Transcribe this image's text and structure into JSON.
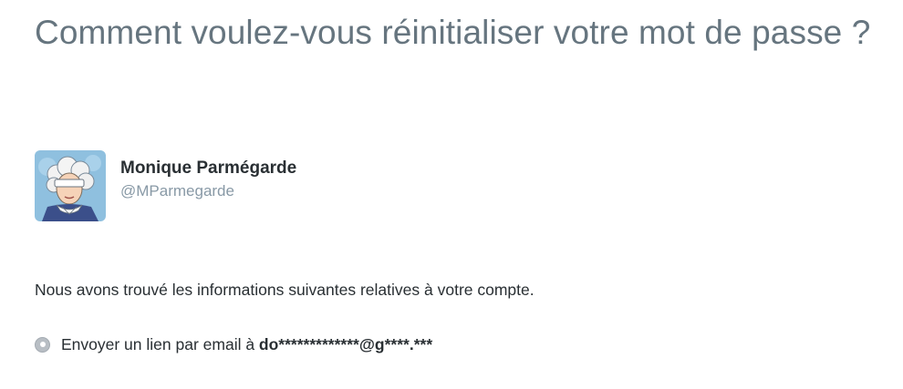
{
  "page": {
    "title": "Comment voulez-vous réinitialiser votre mot de passe ?"
  },
  "account": {
    "avatar_icon": "user-avatar-illustration",
    "name": "Monique Parmégarde",
    "screen_name": "@MParmegarde"
  },
  "info": {
    "found_text": "Nous avons trouvé les informations suivantes relatives à votre compte."
  },
  "reset_option": {
    "label": "Envoyer un lien par email à ",
    "masked_email": "do*************@g****.***",
    "selected": true,
    "icon": "radio-selected-icon"
  },
  "colors": {
    "title": "#66757f",
    "text": "#292f33",
    "muted": "#8899a6"
  }
}
